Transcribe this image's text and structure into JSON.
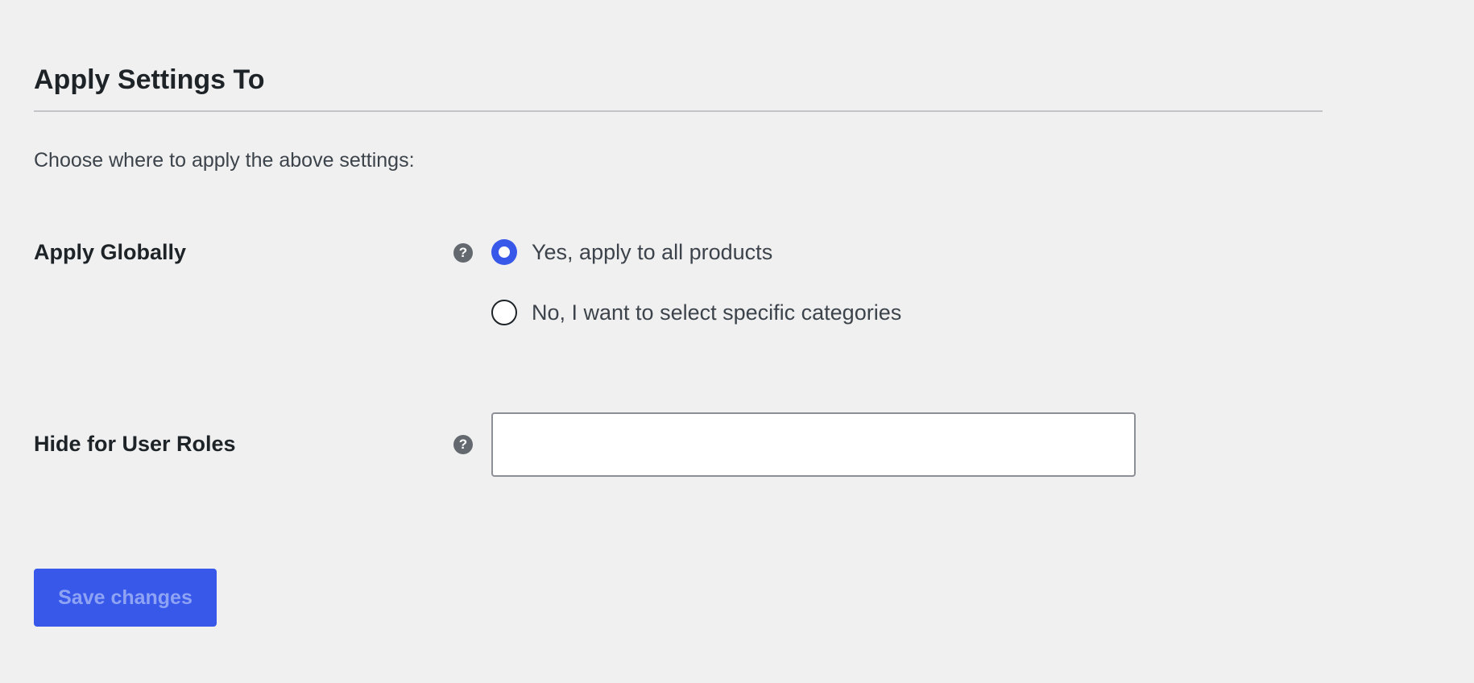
{
  "section": {
    "title": "Apply Settings To",
    "description": "Choose where to apply the above settings:"
  },
  "fields": {
    "apply_globally": {
      "label": "Apply Globally",
      "help_icon": "question-mark-icon",
      "options": [
        {
          "label": "Yes, apply to all products",
          "checked": true
        },
        {
          "label": "No, I want to select specific categories",
          "checked": false
        }
      ]
    },
    "hide_for_user_roles": {
      "label": "Hide for User Roles",
      "help_icon": "question-mark-icon",
      "value": "",
      "placeholder": ""
    }
  },
  "actions": {
    "save_label": "Save changes"
  },
  "colors": {
    "accent": "#3858e9",
    "background": "#f0f0f1",
    "button_text": "#8fa3f5"
  }
}
